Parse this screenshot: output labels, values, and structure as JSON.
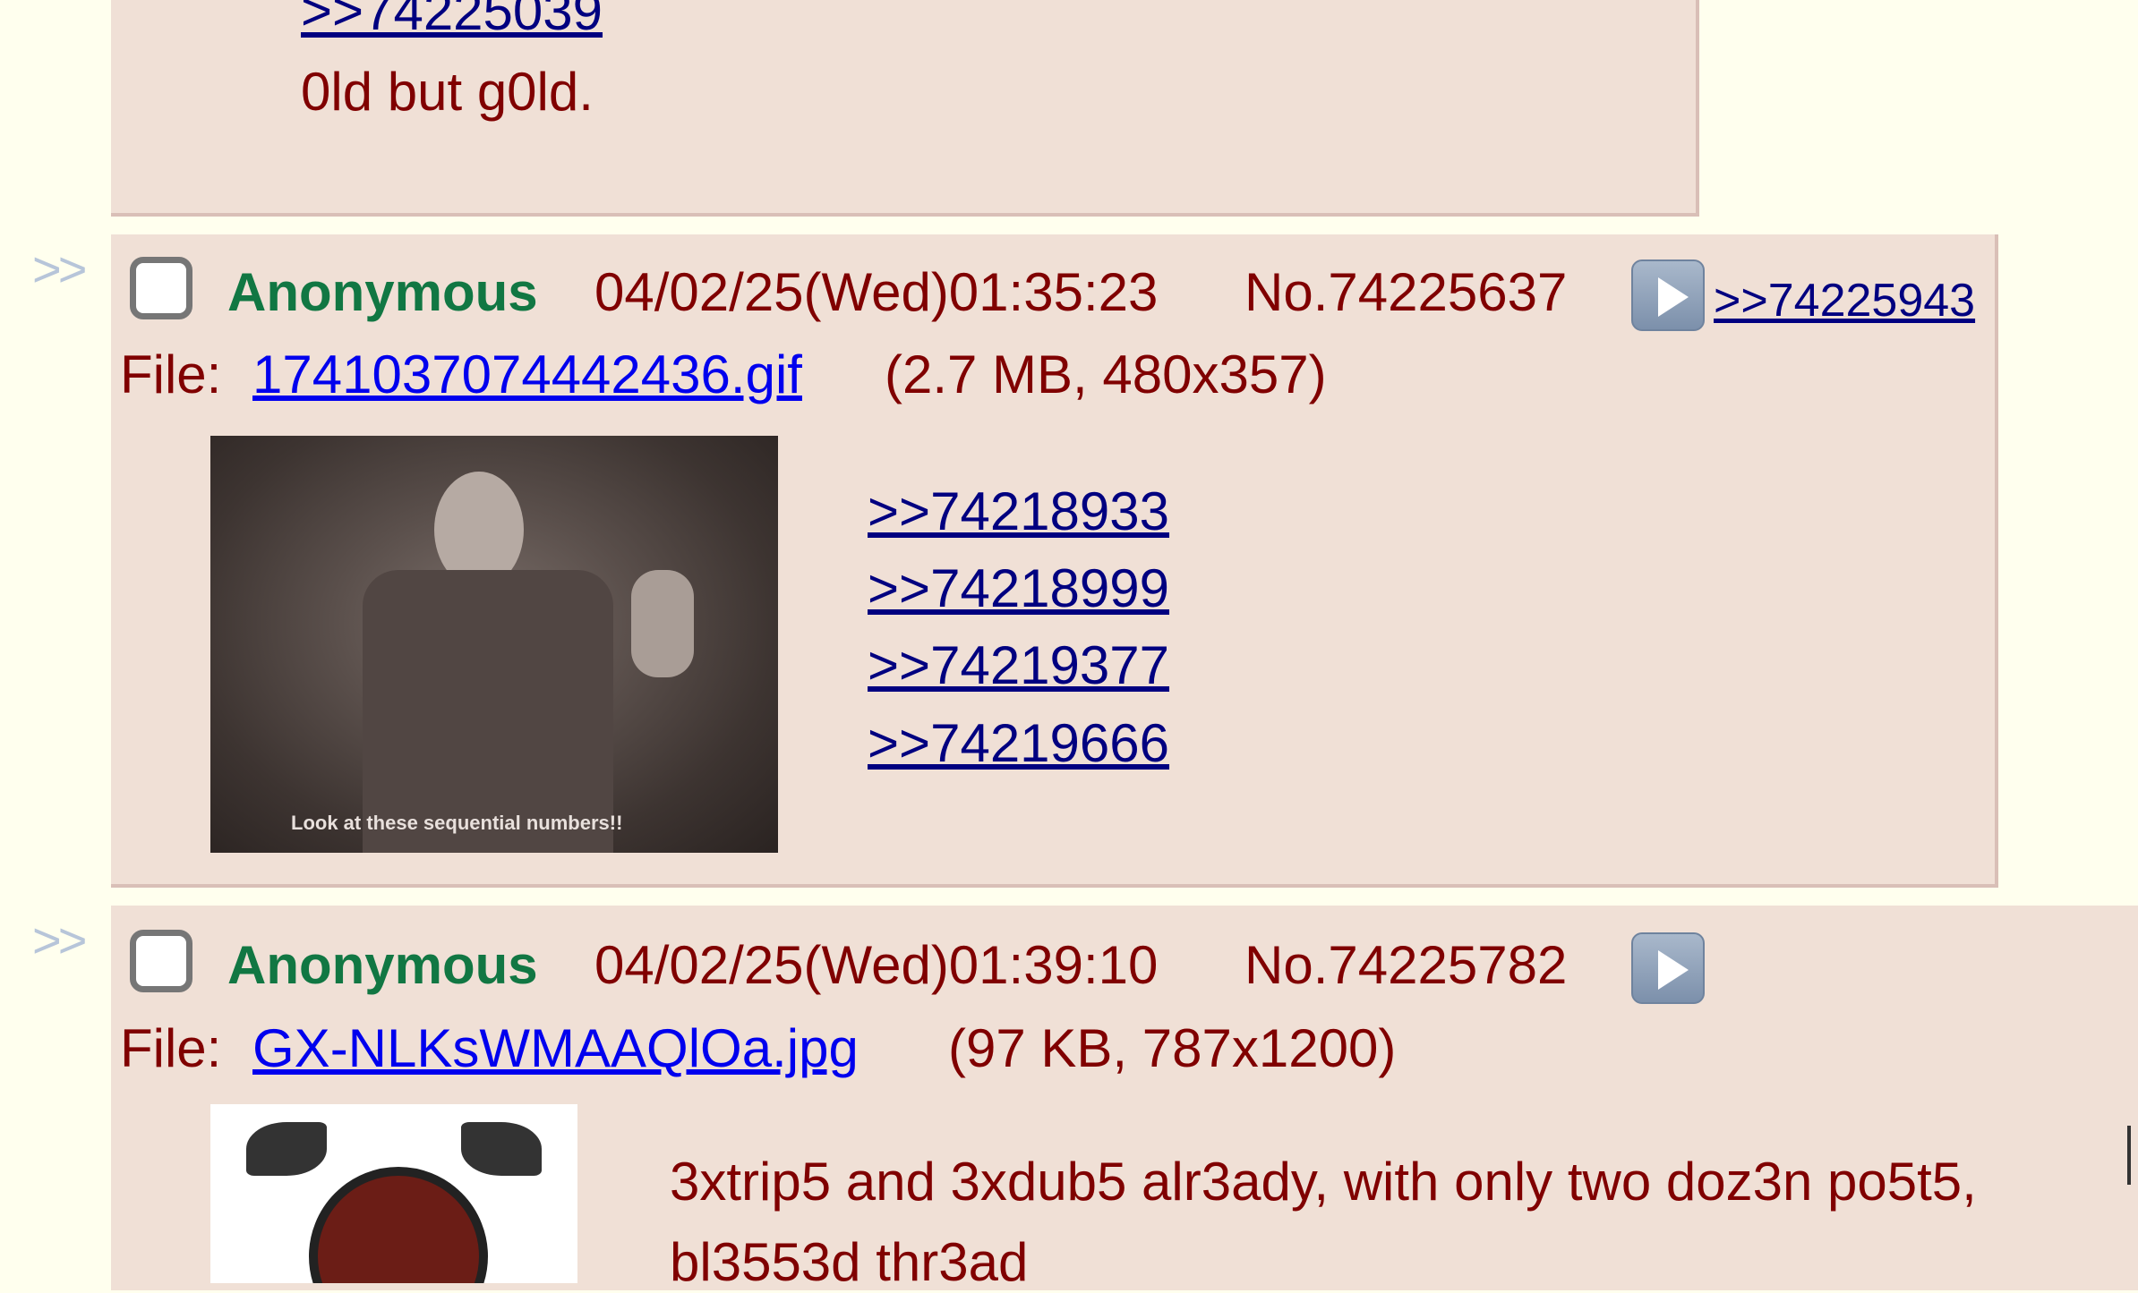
{
  "posts": [
    {
      "quote": ">>74225039",
      "body": "0ld but g0ld."
    },
    {
      "arrows": ">>",
      "name": "Anonymous",
      "datetime": "04/02/25(Wed)01:35:23",
      "number": "No.74225637",
      "reply_link": ">>74225943",
      "file_label": "File:",
      "file_name": "1741037074442436.gif",
      "file_info": "(2.7 MB, 480x357)",
      "thumbnail_caption": "Look at these sequential numbers!!",
      "quotes": [
        ">>74218933",
        ">>74218999",
        ">>74219377",
        ">>74219666"
      ]
    },
    {
      "arrows": ">>",
      "name": "Anonymous",
      "datetime": "04/02/25(Wed)01:39:10",
      "number": "No.74225782",
      "file_label": "File:",
      "file_name": "GX-NLKsWMAAQlOa.jpg",
      "file_info": "(97 KB, 787x1200)",
      "body_line1": "3xtrip5 and 3xdub5 alr3ady, with only two doz3n po5t5,",
      "body_line2": "bl3553d thr3ad"
    }
  ],
  "colors": {
    "background": "#ffffee",
    "post_bg": "#f0e0d6",
    "name": "#117743",
    "text": "#800000",
    "quote_link": "#000080",
    "file_link": "#0000ee"
  },
  "icons": [
    "checkbox-icon",
    "play-icon",
    "double-arrow-icon"
  ]
}
